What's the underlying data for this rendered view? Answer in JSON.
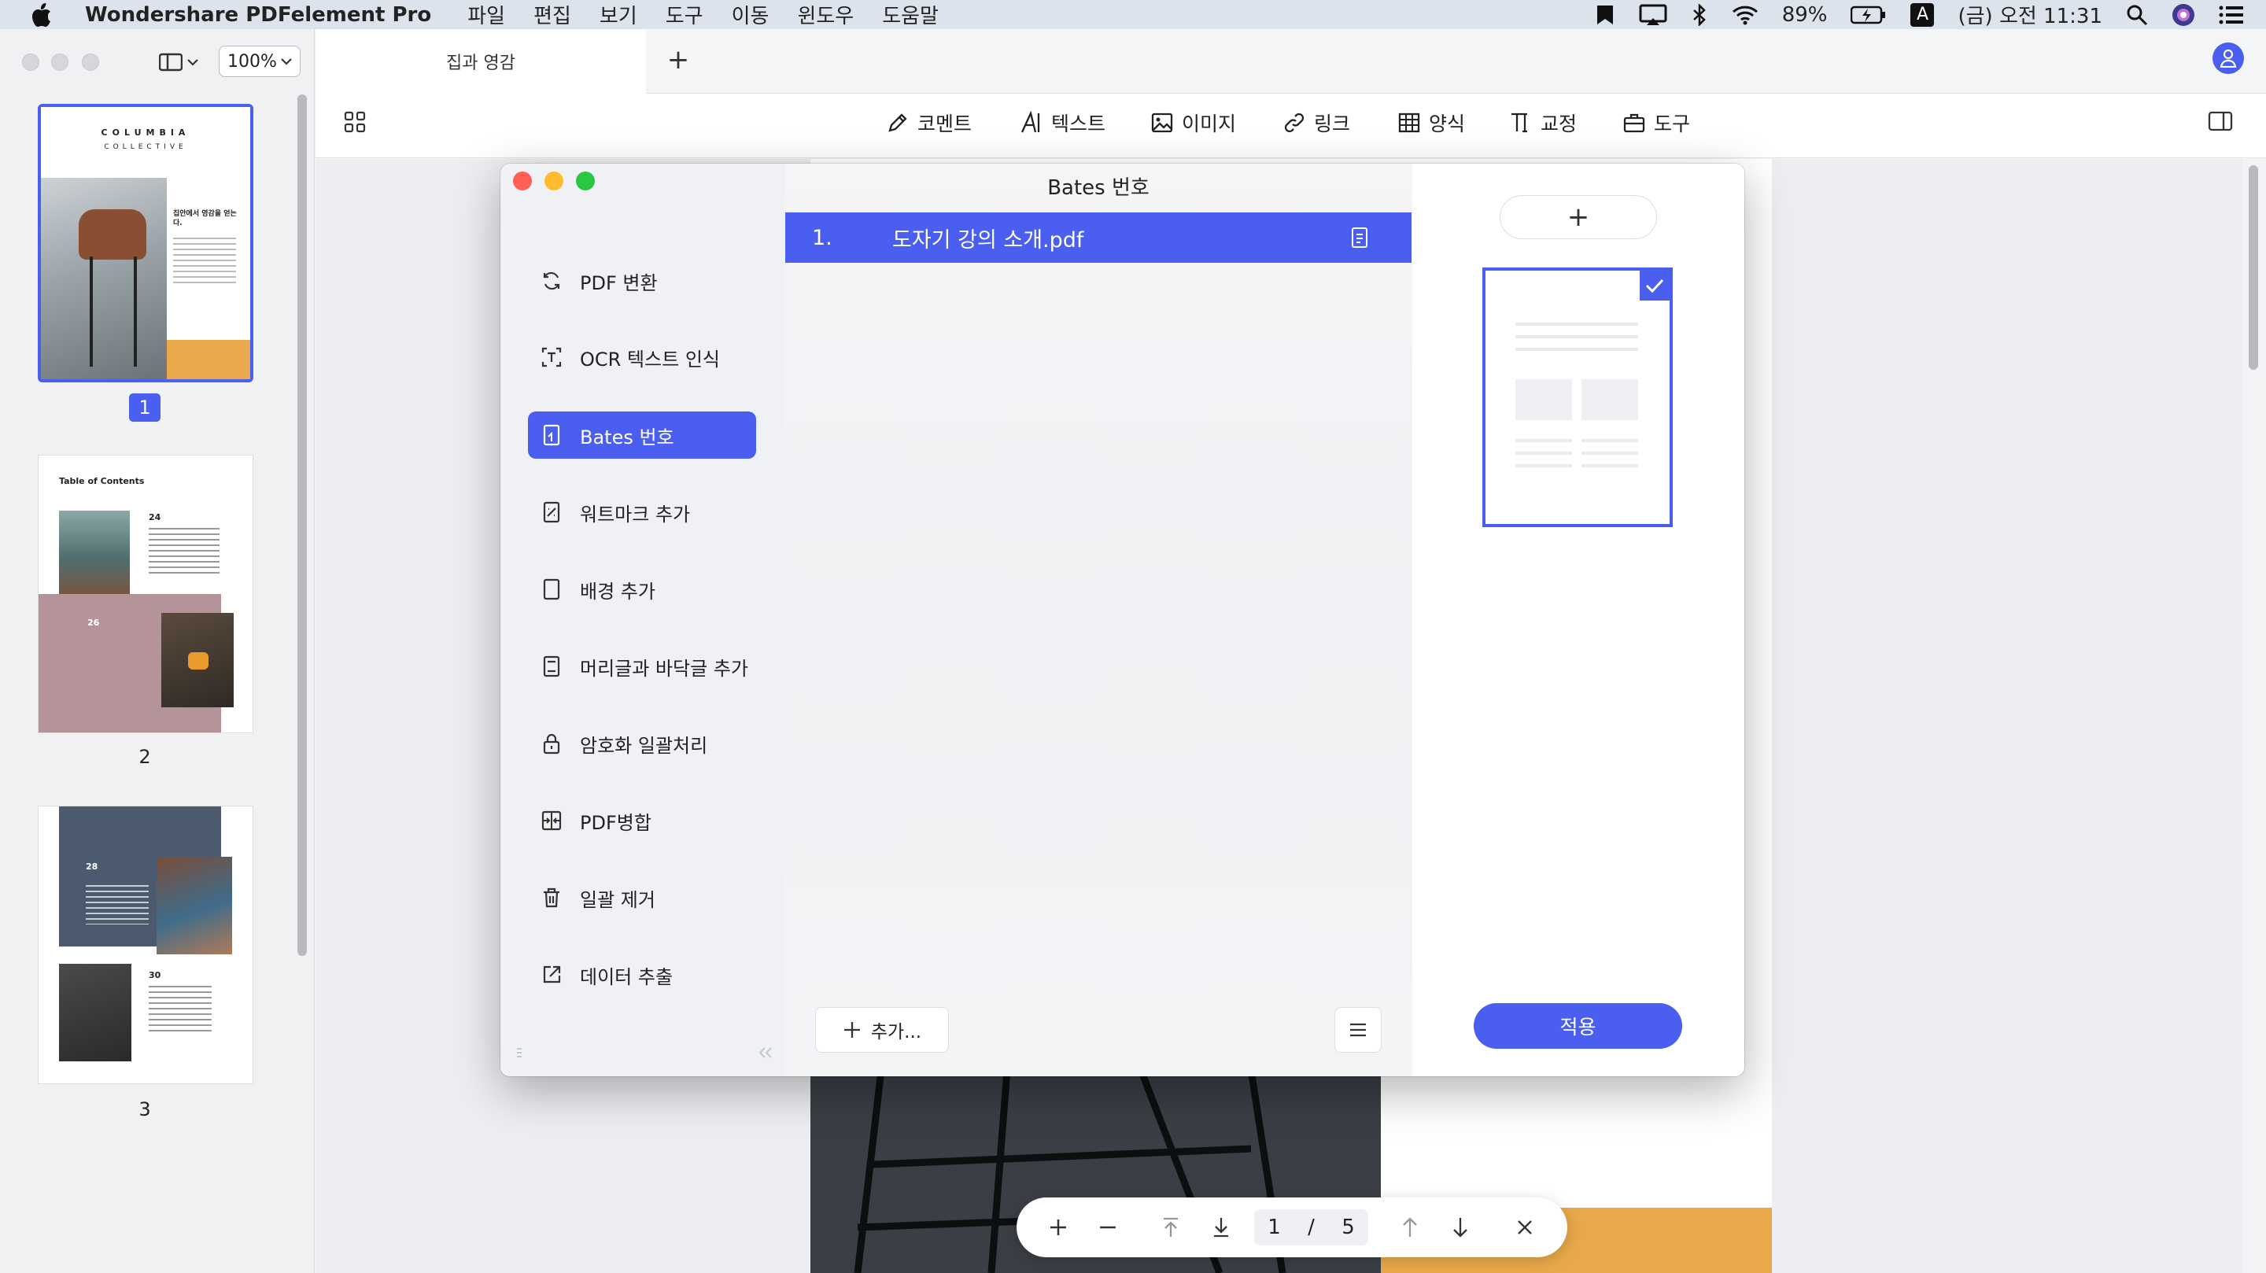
{
  "menubar": {
    "app_name": "Wondershare PDFelement Pro",
    "menus": [
      "파일",
      "편집",
      "보기",
      "도구",
      "이동",
      "윈도우",
      "도움말"
    ],
    "battery": "89%",
    "input_source": "A",
    "clock": "(금) 오전 11:31"
  },
  "window": {
    "zoom": "100%",
    "tab_title": "집과 영감",
    "new_tab": "+"
  },
  "toolbar": {
    "items": [
      {
        "label": "코멘트",
        "icon": "pen-icon"
      },
      {
        "label": "텍스트",
        "icon": "text-icon"
      },
      {
        "label": "이미지",
        "icon": "image-icon"
      },
      {
        "label": "링크",
        "icon": "link-icon"
      },
      {
        "label": "양식",
        "icon": "table-icon"
      },
      {
        "label": "교정",
        "icon": "redact-icon"
      },
      {
        "label": "도구",
        "icon": "toolbox-icon"
      }
    ]
  },
  "thumbnails": {
    "pages": [
      {
        "number": "1",
        "title": "COLUMBIA",
        "subtitle": "COLLECTIVE",
        "heading": "집안에서 영감을 얻는다.",
        "selected": true
      },
      {
        "number": "2",
        "title": "Table of Contents",
        "entries": [
          "24",
          "26"
        ],
        "selected": false
      },
      {
        "number": "3",
        "entries": [
          "28",
          "30"
        ],
        "selected": false
      }
    ]
  },
  "dialog": {
    "title": "Bates 번호",
    "sidebar": [
      {
        "label": "PDF 변환",
        "icon": "convert-icon"
      },
      {
        "label": "OCR 텍스트 인식",
        "icon": "ocr-icon"
      },
      {
        "label": "Bates 번호",
        "icon": "bates-icon",
        "active": true
      },
      {
        "label": "워트마크 추가",
        "icon": "watermark-icon"
      },
      {
        "label": "배경 추가",
        "icon": "background-icon"
      },
      {
        "label": "머리글과 바닥글 추가",
        "icon": "header-footer-icon"
      },
      {
        "label": "암호화 일괄처리",
        "icon": "lock-icon"
      },
      {
        "label": "PDF병합",
        "icon": "merge-icon"
      },
      {
        "label": "일괄 제거",
        "icon": "trash-icon"
      },
      {
        "label": "데이터 추출",
        "icon": "export-icon"
      }
    ],
    "files": [
      {
        "index": "1.",
        "name": "도자기 강의 소개.pdf"
      }
    ],
    "add_button": "추가...",
    "apply_button": "적용",
    "template_add": "+"
  },
  "navigation": {
    "current_page": "1",
    "separator": "/",
    "total_pages": "5"
  },
  "colors": {
    "accent": "#4a5ef0",
    "orange": "#e9a84a",
    "close": "#ff5f57",
    "minimize": "#febc2e",
    "zoom": "#28c840"
  }
}
